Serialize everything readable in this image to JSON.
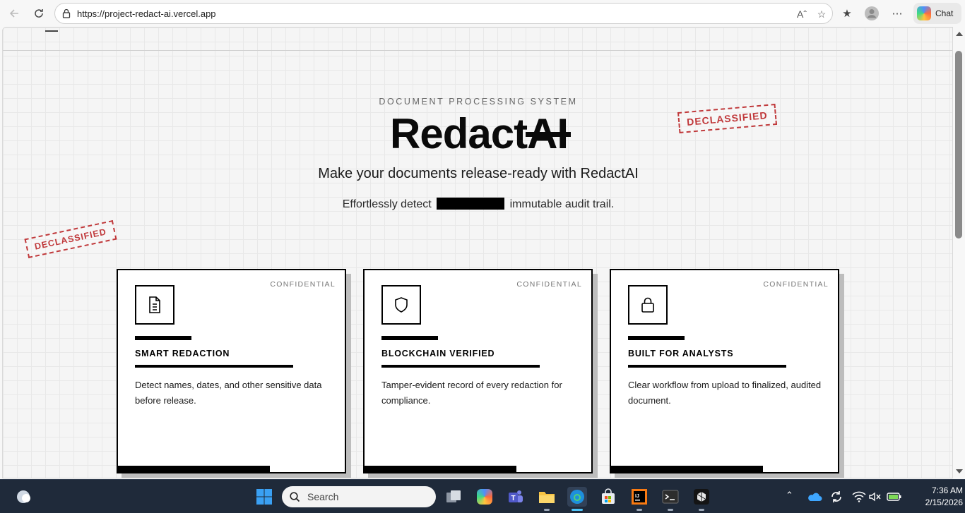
{
  "browser": {
    "url": "https://project-redact-ai.vercel.app",
    "chat_label": "Chat"
  },
  "hero": {
    "eyebrow": "DOCUMENT PROCESSING SYSTEM",
    "brand_main": "Redact",
    "brand_strike": "AI",
    "tagline": "Make your documents release-ready with RedactAI",
    "sub_before": "Effortlessly detect",
    "sub_after": "immutable audit trail."
  },
  "stamps": [
    "DECLASSIFIED",
    "DECLASSIFIED"
  ],
  "cards": [
    {
      "tag": "CONFIDENTIAL",
      "icon": "document-icon",
      "title": "SMART REDACTION",
      "desc": "Detect names, dates, and other sensitive data before release."
    },
    {
      "tag": "CONFIDENTIAL",
      "icon": "shield-icon",
      "title": "BLOCKCHAIN VERIFIED",
      "desc": "Tamper-evident record of every redaction for compliance."
    },
    {
      "tag": "CONFIDENTIAL",
      "icon": "lock-icon",
      "title": "BUILT FOR ANALYSTS",
      "desc": "Clear workflow from upload to finalized, audited document."
    }
  ],
  "taskbar": {
    "search_label": "Search",
    "time": "7:36 AM",
    "date": "2/15/2026"
  },
  "colors": {
    "stamp_red": "#c0393b",
    "taskbar_bg": "#1f2a3a",
    "accent_blue": "#4fc3f7"
  }
}
